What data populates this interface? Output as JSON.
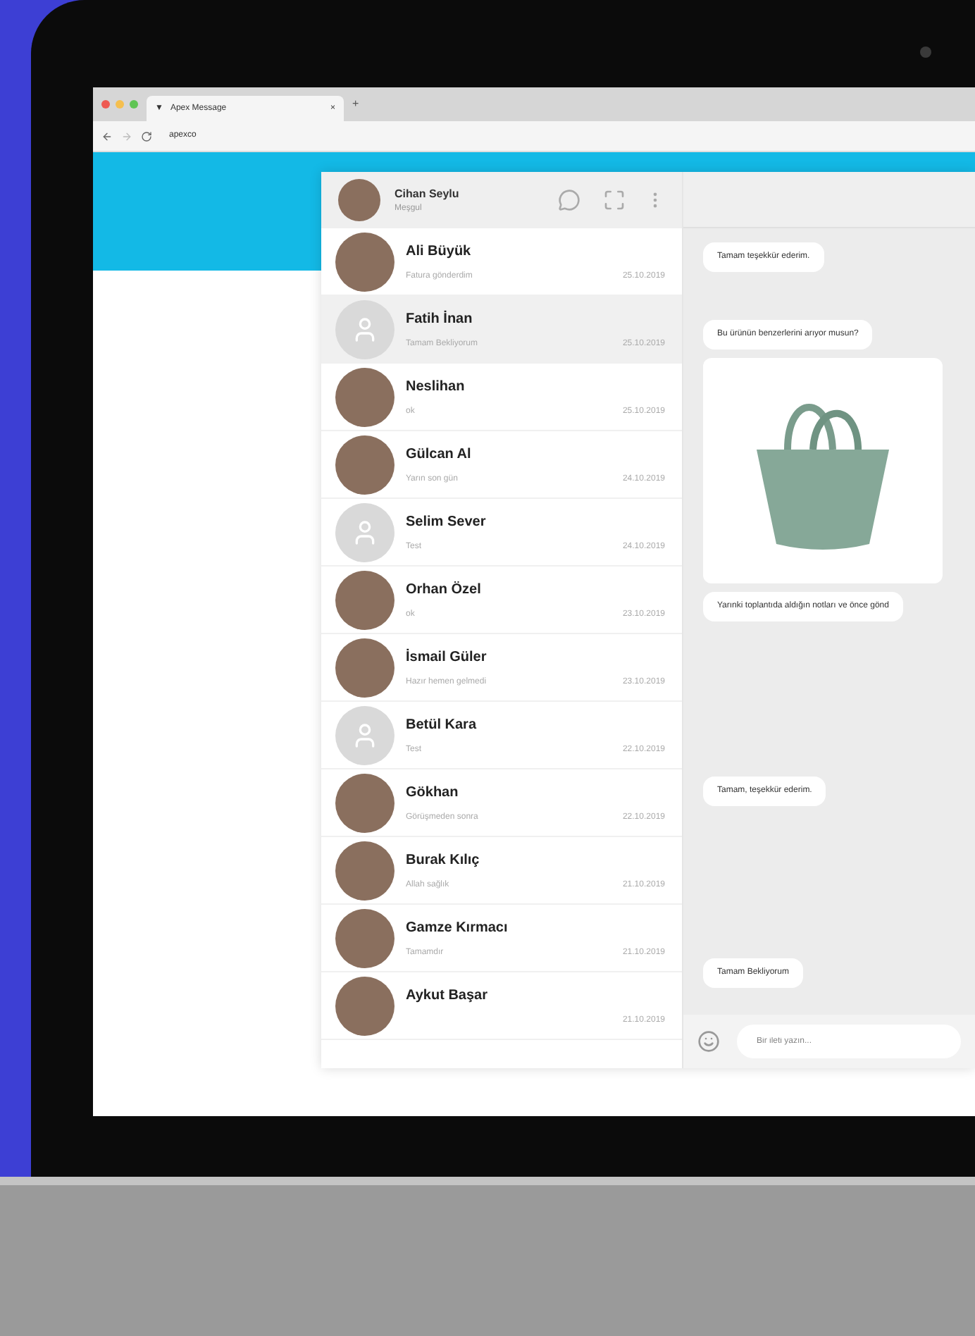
{
  "browser": {
    "tab_icon": "▼",
    "tab_title": "Apex Message",
    "tab_close": "×",
    "new_tab": "+",
    "address": "apexco"
  },
  "profile": {
    "name": "Cihan Seylu",
    "status": "Meşgul"
  },
  "contacts": [
    {
      "name": "Ali Büyük",
      "preview": "Fatura gönderdim",
      "date": "25.10.2019",
      "kind": "photo",
      "selected": false
    },
    {
      "name": "Fatih İnan",
      "preview": "Tamam Bekliyorum",
      "date": "25.10.2019",
      "kind": "placeholder",
      "selected": true
    },
    {
      "name": "Neslihan",
      "preview": "ok",
      "date": "25.10.2019",
      "kind": "photo",
      "selected": false
    },
    {
      "name": "Gülcan Al",
      "preview": "Yarın son gün",
      "date": "24.10.2019",
      "kind": "photo",
      "selected": false
    },
    {
      "name": "Selim Sever",
      "preview": "Test",
      "date": "24.10.2019",
      "kind": "placeholder",
      "selected": false
    },
    {
      "name": "Orhan Özel",
      "preview": "ok",
      "date": "23.10.2019",
      "kind": "photo",
      "selected": false
    },
    {
      "name": "İsmail Güler",
      "preview": "Hazır hemen gelmedi",
      "date": "23.10.2019",
      "kind": "photo",
      "selected": false
    },
    {
      "name": "Betül Kara",
      "preview": "Test",
      "date": "22.10.2019",
      "kind": "placeholder",
      "selected": false
    },
    {
      "name": "Gökhan",
      "preview": "Görüşmeden sonra",
      "date": "22.10.2019",
      "kind": "photo",
      "selected": false
    },
    {
      "name": "Burak Kılıç",
      "preview": "Allah sağlık",
      "date": "21.10.2019",
      "kind": "photo",
      "selected": false
    },
    {
      "name": "Gamze Kırmacı",
      "preview": "Tamamdır",
      "date": "21.10.2019",
      "kind": "photo",
      "selected": false
    },
    {
      "name": "Aykut Başar",
      "date": "21.10.2019",
      "kind": "photo",
      "selected": false
    }
  ],
  "messages": [
    {
      "kind": "text",
      "text": "Tamam teşekkür ederim."
    },
    {
      "kind": "text",
      "text": "Bu ürünün benzerlerini arıyor musun?"
    },
    {
      "kind": "image"
    },
    {
      "kind": "text",
      "text": "Yarınki toplantıda aldığın notları ve önce gönd"
    },
    {
      "kind": "text",
      "text": "Tamam, teşekkür ederim."
    },
    {
      "kind": "text",
      "text": "Tamam Bekliyorum"
    }
  ],
  "composer": {
    "placeholder": "Bir ileti yazın..."
  }
}
